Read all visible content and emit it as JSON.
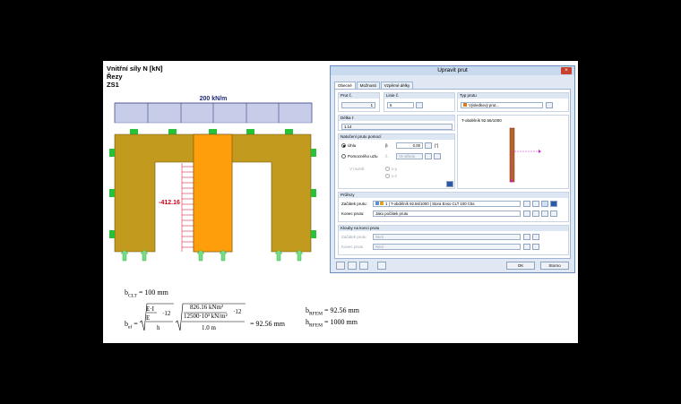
{
  "drawing": {
    "header_line1": "Vnitřní síly N [kN]",
    "header_line2": "Řezy",
    "header_line3": "ZS1",
    "load_label": "200 kN/m",
    "force_label": "-412.16"
  },
  "formulas": {
    "b_clt": "b",
    "b_clt_sub": "CLT",
    "b_clt_val": " = 100 mm",
    "b_ef": "b",
    "b_ef_sub": "ef",
    "formula_left_num": "E·I",
    "formula_left_den": "h",
    "formula_left_mid": "·12",
    "formula_left_frac_den": "E",
    "formula_right_num": "826.16 kNm²",
    "formula_right_den1": "12500·10³ kN/m²",
    "formula_right_mid": "·12",
    "formula_right_den": "1.0 m",
    "formula_result": "= 92.56 mm",
    "b_rfem": "b",
    "b_rfem_sub": "RFEM",
    "b_rfem_val": " = 92.56 mm",
    "h_rfem": "h",
    "h_rfem_sub": "RFEM",
    "h_rfem_val": " = 1000 mm"
  },
  "dialog": {
    "title": "Upravit prut",
    "close": "×",
    "tabs": [
      "Obecné",
      "Možnosti",
      "Vzpěrné délky"
    ],
    "prut_no_label": "Prut č.",
    "prut_no_value": "1",
    "line_no_label": "Linie č.",
    "line_no_value": "5",
    "type_label": "Typ prutu",
    "type_value": "Výsledkový prut...",
    "length_label": "Délka ℓ",
    "length_value": "1.14",
    "rotation_group": "Natočení prutu pomocí",
    "rot_angle_label": "Úhlu",
    "rot_beta": "β",
    "rot_angle_value": "0.00",
    "rot_angle_unit": "[°]",
    "rot_node_label": "Pomocného uzlu",
    "rot_node_field_label": "č.",
    "rot_node_value": "Ve středu",
    "plane_label": "V rovině",
    "plane_xy": "x-y",
    "plane_xz": "x-z",
    "preview_label": "T-obdélník 92.56/1000",
    "sections_group": "Průřezy",
    "start_label": "Začátek prutu:",
    "start_no": "1",
    "start_section": "T-obdélník 92.56/1000",
    "start_material": "Stora Enso CLT 100 C5s",
    "end_label": "Konec prutu:",
    "end_value": "Jako počátek prutu",
    "hinges_group": "Klouby na konci prutu",
    "hinge_start_label": "Začátek prutu",
    "hinge_start_value": "Není",
    "hinge_end_label": "Konec prutu",
    "hinge_end_value": "Není",
    "ok": "OK",
    "cancel": "Storno"
  },
  "colors": {
    "frame": "#c19a1e",
    "column": "#ff9e0b",
    "support": "#27c23a",
    "load": "#c7cde8",
    "force_text": "#d0021b"
  }
}
